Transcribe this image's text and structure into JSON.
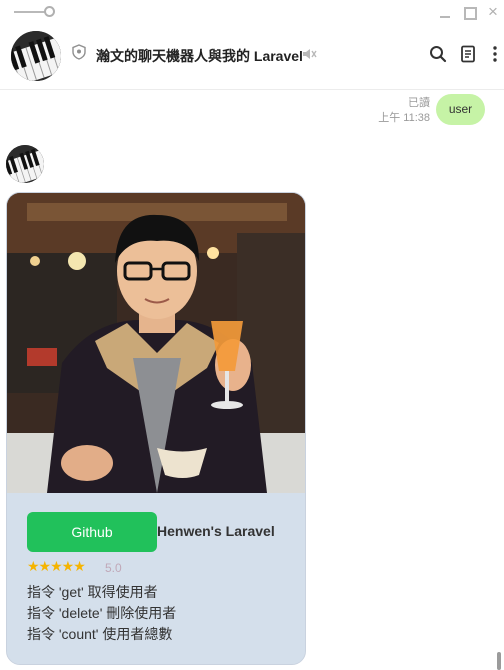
{
  "window": {
    "controls": [
      "minimize",
      "maximize",
      "close"
    ],
    "close_glyph": "×"
  },
  "header": {
    "title": "瀚文的聊天機器人與我的 Laravel",
    "icons": [
      "shield-icon",
      "mute-icon",
      "search-icon",
      "notes-icon",
      "more-icon"
    ]
  },
  "messages": {
    "read_label": "已讀",
    "time_label": "上午 11:38",
    "user_bubble": "user"
  },
  "card": {
    "button_label": "Github",
    "title": "Henwen's Laravel",
    "stars": "★★★★★",
    "rating": "5.0",
    "rating_value": 5,
    "commands": [
      "指令 'get' 取得使用者",
      "指令 'delete' 刪除使用者",
      "指令 'count' 使用者總數"
    ]
  },
  "colors": {
    "user_bubble": "#c6f3a6",
    "button": "#21c15b",
    "card_body": "#d4dfeb",
    "star": "#f5b400"
  }
}
